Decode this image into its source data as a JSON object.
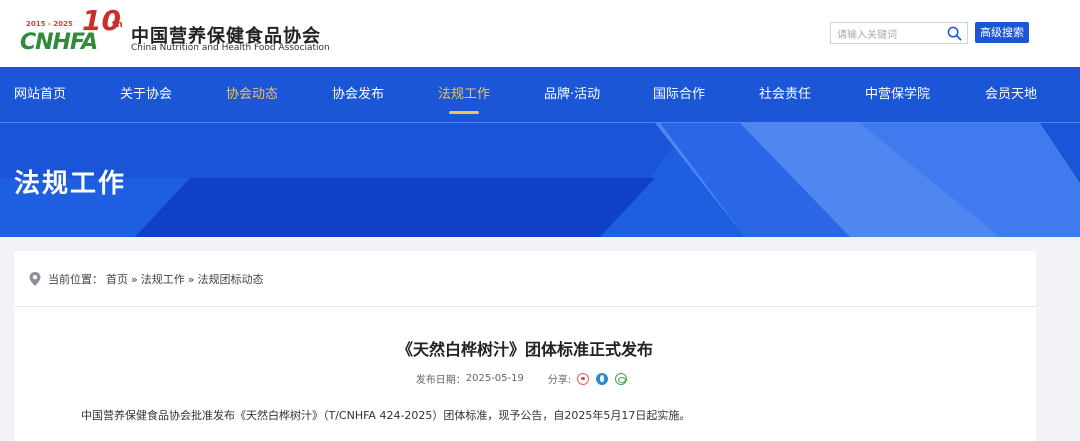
{
  "header": {
    "logo": {
      "years": "2015 - 2025",
      "mark": "CNHFA",
      "ten": "10",
      "th": "th"
    },
    "org_name_cn": "中国营养保健食品协会",
    "org_name_en": "China Nutrition and Health Food Association",
    "search": {
      "placeholder": "请输入关键词",
      "button_label": "高级搜索"
    }
  },
  "nav": {
    "items": [
      {
        "label": "网站首页"
      },
      {
        "label": "关于协会"
      },
      {
        "label": "协会动态"
      },
      {
        "label": "协会发布"
      },
      {
        "label": "法规工作"
      },
      {
        "label": "品牌·活动"
      },
      {
        "label": "国际合作"
      },
      {
        "label": "社会责任"
      },
      {
        "label": "中营保学院"
      },
      {
        "label": "会员天地"
      }
    ],
    "active_index": 4,
    "highlight_index": 2
  },
  "banner": {
    "title": "法规工作"
  },
  "breadcrumb": {
    "prefix": "当前位置：",
    "items": [
      "首页",
      "法规工作",
      "法规团标动态"
    ],
    "separator": "»"
  },
  "article": {
    "title": "《天然白桦树汁》团体标准正式发布",
    "date_label": "发布日期：",
    "date": "2025-05-19",
    "share_label": "分享:",
    "body": "中国营养保健食品协会批准发布《天然白桦树汁》（T/CNHFA 424-2025）团体标准，现予公告，自2025年5月17日起实施。"
  },
  "colors": {
    "primary": "#1a56d6",
    "accent_gold": "#f0c35b",
    "banner_blue": "#1e5ee0",
    "page_bg": "#f2f3f6"
  }
}
